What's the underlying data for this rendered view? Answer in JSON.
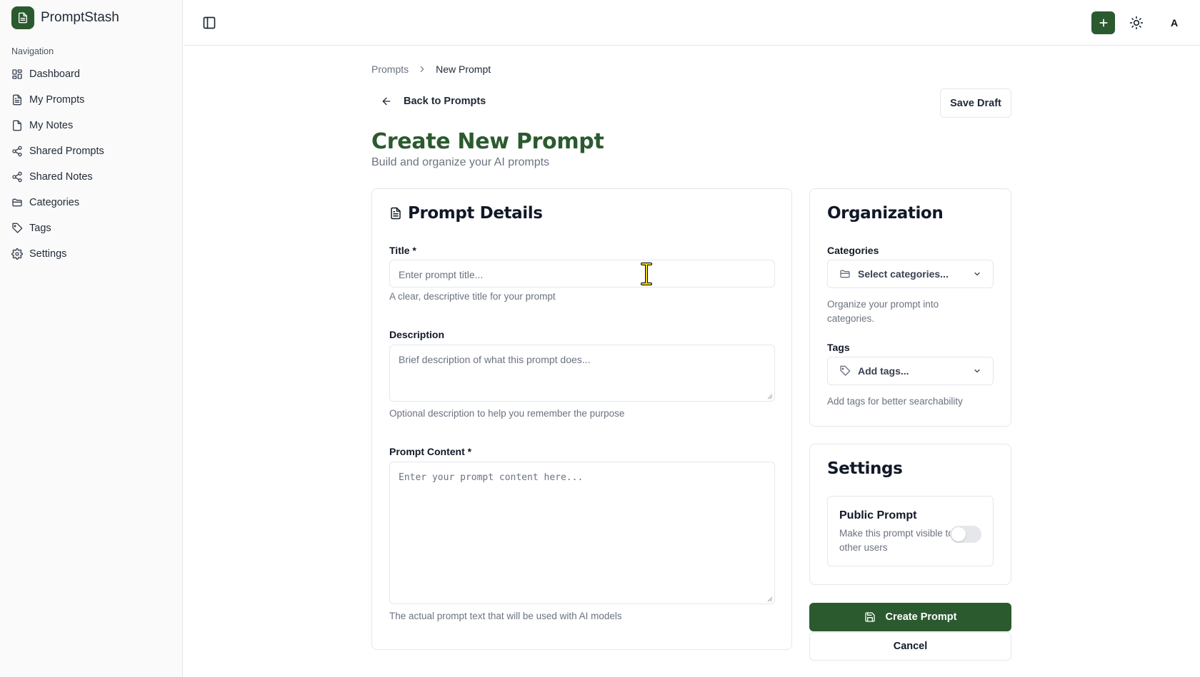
{
  "app": {
    "name": "PromptStash"
  },
  "sidebar": {
    "heading": "Navigation",
    "items": [
      {
        "label": "Dashboard",
        "icon": "dashboard-icon"
      },
      {
        "label": "My Prompts",
        "icon": "file-text-icon"
      },
      {
        "label": "My Notes",
        "icon": "file-icon"
      },
      {
        "label": "Shared Prompts",
        "icon": "share-icon"
      },
      {
        "label": "Shared Notes",
        "icon": "share-icon"
      },
      {
        "label": "Categories",
        "icon": "folder-icon"
      },
      {
        "label": "Tags",
        "icon": "tag-icon"
      },
      {
        "label": "Settings",
        "icon": "gear-icon"
      }
    ]
  },
  "header": {
    "avatar_initial": "A"
  },
  "breadcrumb": {
    "parent": "Prompts",
    "current": "New Prompt"
  },
  "actions": {
    "back_label": "Back to Prompts",
    "save_draft_label": "Save Draft"
  },
  "page": {
    "title": "Create New Prompt",
    "subtitle": "Build and organize your AI prompts"
  },
  "details": {
    "title": "Prompt Details",
    "title_field": {
      "label": "Title *",
      "placeholder": "Enter prompt title...",
      "help": "A clear, descriptive title for your prompt"
    },
    "description_field": {
      "label": "Description",
      "placeholder": "Brief description of what this prompt does...",
      "help": "Optional description to help you remember the purpose"
    },
    "content_field": {
      "label": "Prompt Content *",
      "placeholder": "Enter your prompt content here...",
      "help": "The actual prompt text that will be used with AI models"
    }
  },
  "organization": {
    "title": "Organization",
    "categories": {
      "label": "Categories",
      "placeholder": "Select categories...",
      "help": "Organize your prompt into categories."
    },
    "tags": {
      "label": "Tags",
      "placeholder": "Add tags...",
      "help": "Add tags for better searchability"
    }
  },
  "settings": {
    "title": "Settings",
    "public": {
      "label": "Public Prompt",
      "description": "Make this prompt visible to other users",
      "enabled": false
    }
  },
  "footer_actions": {
    "create_label": "Create Prompt",
    "cancel_label": "Cancel"
  },
  "colors": {
    "accent": "#2b5a2f",
    "border": "#e5e7eb",
    "muted_text": "#6b7280"
  }
}
